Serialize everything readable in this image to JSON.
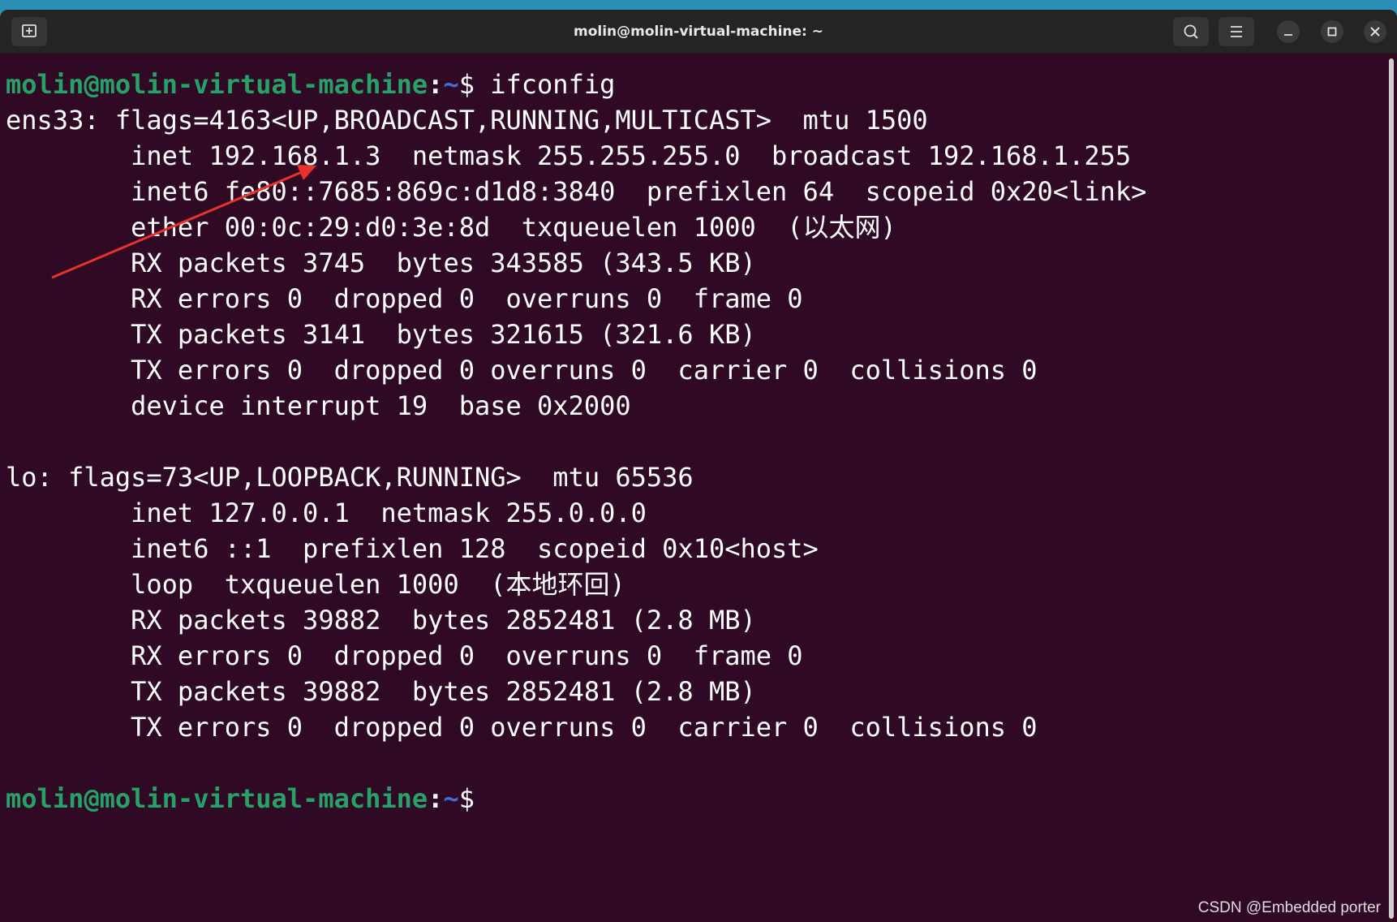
{
  "window": {
    "title": "molin@molin-virtual-machine: ~",
    "buttons": {
      "new_tab_icon": "new-tab-icon",
      "search_icon": "search-icon",
      "menu_icon": "hamburger-menu-icon",
      "minimize_icon": "minimize-icon",
      "maximize_icon": "maximize-icon",
      "close_icon": "close-icon"
    }
  },
  "colors": {
    "background": "#300a24",
    "prompt_user": "#26a269",
    "prompt_path": "#3e6fd6",
    "text": "#ffffff",
    "annotation_arrow": "#e8322c"
  },
  "terminal": {
    "prompt1": {
      "user": "molin@molin-virtual-machine",
      "sep": ":",
      "path": "~",
      "symbol": "$ ",
      "command": "ifconfig"
    },
    "lines": [
      "ens33: flags=4163<UP,BROADCAST,RUNNING,MULTICAST>  mtu 1500",
      "        inet 192.168.1.3  netmask 255.255.255.0  broadcast 192.168.1.255",
      "        inet6 fe80::7685:869c:d1d8:3840  prefixlen 64  scopeid 0x20<link>",
      "        ether 00:0c:29:d0:3e:8d  txqueuelen 1000  (以太网)",
      "        RX packets 3745  bytes 343585 (343.5 KB)",
      "        RX errors 0  dropped 0  overruns 0  frame 0",
      "        TX packets 3141  bytes 321615 (321.6 KB)",
      "        TX errors 0  dropped 0 overruns 0  carrier 0  collisions 0",
      "        device interrupt 19  base 0x2000",
      "",
      "lo: flags=73<UP,LOOPBACK,RUNNING>  mtu 65536",
      "        inet 127.0.0.1  netmask 255.0.0.0",
      "        inet6 ::1  prefixlen 128  scopeid 0x10<host>",
      "        loop  txqueuelen 1000  (本地环回)",
      "        RX packets 39882  bytes 2852481 (2.8 MB)",
      "        RX errors 0  dropped 0  overruns 0  frame 0",
      "        TX packets 39882  bytes 2852481 (2.8 MB)",
      "        TX errors 0  dropped 0 overruns 0  carrier 0  collisions 0",
      ""
    ],
    "prompt2": {
      "user": "molin@molin-virtual-machine",
      "sep": ":",
      "path": "~",
      "symbol": "$"
    }
  },
  "watermark": "CSDN @Embedded porter"
}
